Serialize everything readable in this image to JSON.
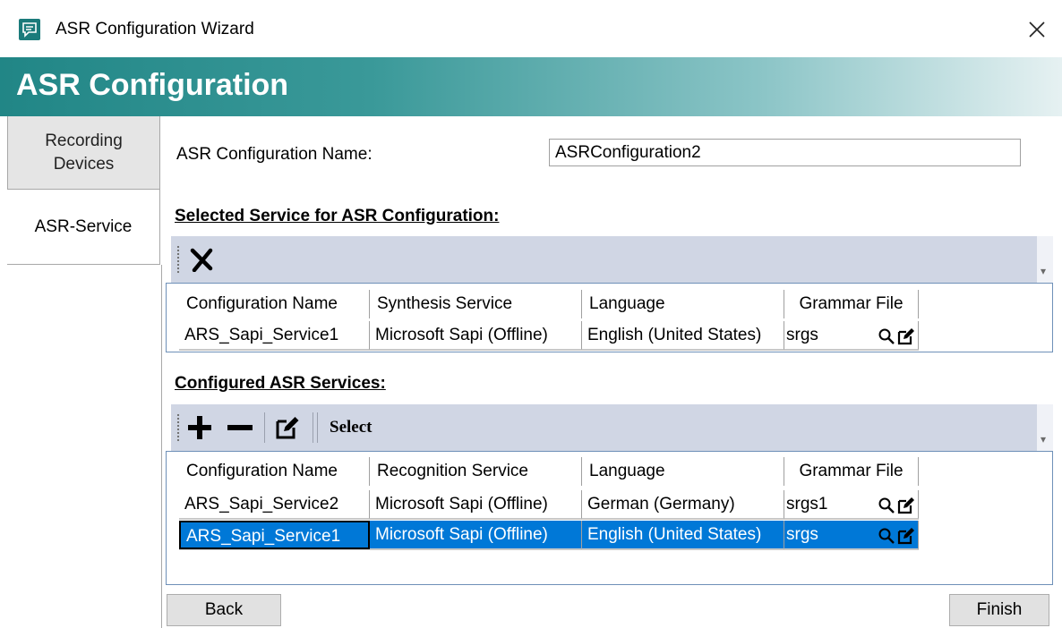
{
  "window": {
    "title": "ASR Configuration Wizard",
    "app_icon": "speech-bubble-icon",
    "close_icon": "close-icon"
  },
  "banner": {
    "title": "ASR Configuration"
  },
  "tabs": [
    {
      "label_line1": "Recording",
      "label_line2": "Devices"
    },
    {
      "label": "ASR-Service"
    }
  ],
  "form": {
    "name_label": "ASR Configuration Name:",
    "name_value": "ASRConfiguration2"
  },
  "selected_section": {
    "title": "Selected Service for ASR Configuration:",
    "toolbar": {
      "remove_icon": "x-icon"
    },
    "columns": [
      "Configuration Name",
      "Synthesis Service",
      "Language",
      "Grammar File"
    ],
    "rows": [
      [
        "ARS_Sapi_Service1",
        "Microsoft Sapi (Offline)",
        "English (United States)",
        "srgs"
      ]
    ]
  },
  "configured_section": {
    "title": "Configured ASR Services:",
    "toolbar": {
      "add_icon": "plus-icon",
      "remove_icon": "minus-icon",
      "edit_icon": "edit-icon",
      "select_label": "Select"
    },
    "columns": [
      "Configuration Name",
      "Recognition Service",
      "Language",
      "Grammar File"
    ],
    "rows": [
      [
        "ARS_Sapi_Service2",
        "Microsoft Sapi (Offline)",
        "German (Germany)",
        "srgs1"
      ],
      [
        "ARS_Sapi_Service1",
        "Microsoft Sapi (Offline)",
        "English (United States)",
        "srgs"
      ]
    ],
    "selected_row": 1
  },
  "buttons": {
    "back": "Back",
    "finish": "Finish"
  },
  "colors": {
    "banner_start": "#218686",
    "toolbar_bg": "#d0d6e4",
    "selection": "#0078d7",
    "grid_border": "#6e90b8"
  }
}
